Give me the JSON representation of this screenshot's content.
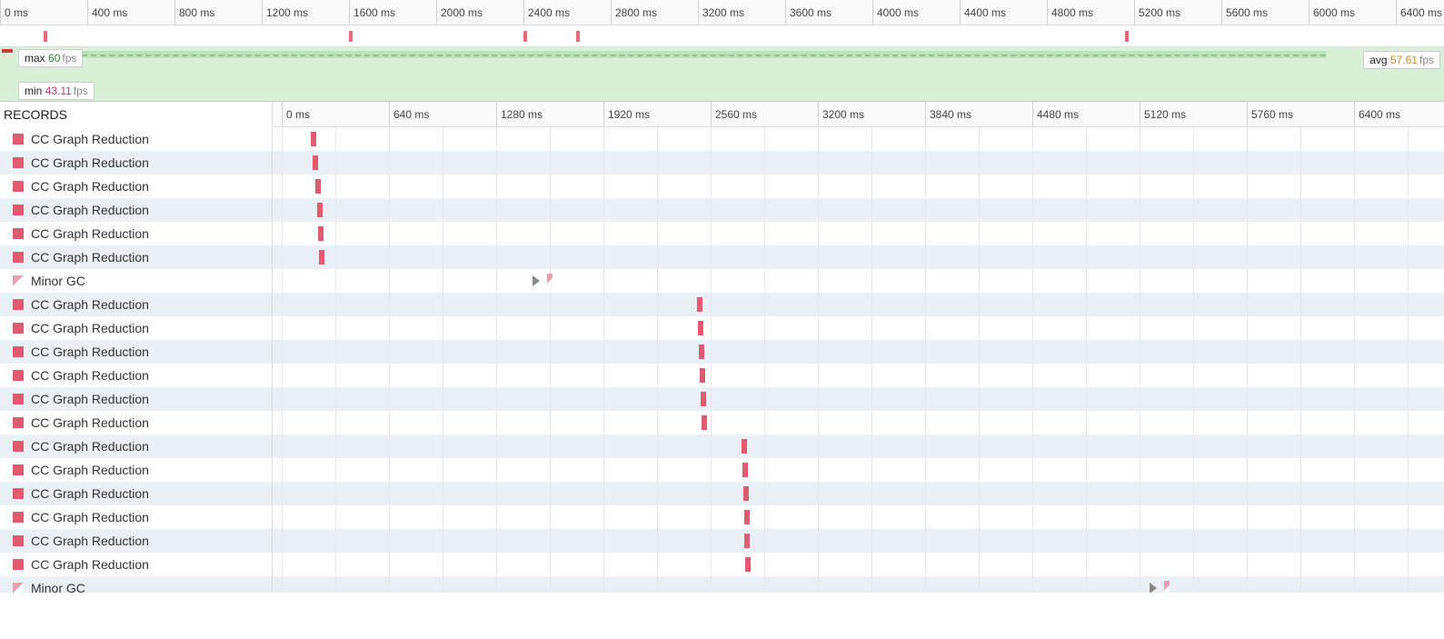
{
  "overview": {
    "ticks": [
      "0 ms",
      "400 ms",
      "800 ms",
      "1200 ms",
      "1600 ms",
      "2000 ms",
      "2400 ms",
      "2800 ms",
      "3200 ms",
      "3600 ms",
      "4000 ms",
      "4400 ms",
      "4800 ms",
      "5200 ms",
      "5600 ms",
      "6000 ms",
      "6400 ms"
    ],
    "tickSpacingPx": 96,
    "totalMs": 6400,
    "markers": [
      200,
      1600,
      2400,
      2640,
      5160
    ]
  },
  "fps": {
    "maxLabel": "max",
    "maxValue": "60",
    "minLabel": "min",
    "minValue": "43.11",
    "avgLabel": "avg",
    "avgValue": "57.61",
    "unit": "fps"
  },
  "records": {
    "heading": "RECORDS",
    "ticks": [
      "0 ms",
      "640 ms",
      "1280 ms",
      "1920 ms",
      "2560 ms",
      "3200 ms",
      "3840 ms",
      "4480 ms",
      "5120 ms",
      "5760 ms",
      "6400 ms"
    ],
    "tickSpacingPx": 118,
    "tickStartPx": 10,
    "totalMs": 6400,
    "gridCount": 22,
    "rows": [
      {
        "label": "CC Graph Reduction",
        "type": "cc",
        "posMs": 170
      },
      {
        "label": "CC Graph Reduction",
        "type": "cc",
        "posMs": 185
      },
      {
        "label": "CC Graph Reduction",
        "type": "cc",
        "posMs": 200
      },
      {
        "label": "CC Graph Reduction",
        "type": "cc",
        "posMs": 210
      },
      {
        "label": "CC Graph Reduction",
        "type": "cc",
        "posMs": 215
      },
      {
        "label": "CC Graph Reduction",
        "type": "cc",
        "posMs": 220
      },
      {
        "label": "Minor GC",
        "type": "minor",
        "posMs": 1570,
        "playBefore": true
      },
      {
        "label": "CC Graph Reduction",
        "type": "cc",
        "posMs": 2460
      },
      {
        "label": "CC Graph Reduction",
        "type": "cc",
        "posMs": 2465
      },
      {
        "label": "CC Graph Reduction",
        "type": "cc",
        "posMs": 2470
      },
      {
        "label": "CC Graph Reduction",
        "type": "cc",
        "posMs": 2475
      },
      {
        "label": "CC Graph Reduction",
        "type": "cc",
        "posMs": 2480
      },
      {
        "label": "CC Graph Reduction",
        "type": "cc",
        "posMs": 2485
      },
      {
        "label": "CC Graph Reduction",
        "type": "cc",
        "posMs": 2720
      },
      {
        "label": "CC Graph Reduction",
        "type": "cc",
        "posMs": 2725
      },
      {
        "label": "CC Graph Reduction",
        "type": "cc",
        "posMs": 2730
      },
      {
        "label": "CC Graph Reduction",
        "type": "cc",
        "posMs": 2735
      },
      {
        "label": "CC Graph Reduction",
        "type": "cc",
        "posMs": 2740
      },
      {
        "label": "CC Graph Reduction",
        "type": "cc",
        "posMs": 2745
      },
      {
        "label": "Minor GC",
        "type": "minor",
        "posMs": 5220,
        "playBefore": true
      }
    ]
  }
}
